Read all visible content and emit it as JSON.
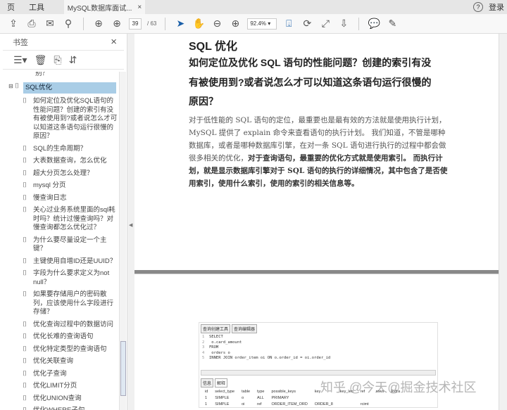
{
  "tabbar": {
    "menu": [
      "页",
      "工具"
    ],
    "doc_tab": "MySQL数据库面试...",
    "close": "×",
    "login": "登录",
    "help": "?"
  },
  "toolbar": {
    "page_current": "39",
    "page_total": "/ 63",
    "zoom": "92.4%"
  },
  "sidebar": {
    "title": "书签",
    "close": "×",
    "items": [
      {
        "label": "别？",
        "level": 1
      },
      {
        "label": "SQL优化",
        "level": 0,
        "selected": true
      },
      {
        "label": "如何定位及优化SQL语句的性能问题？创建的索引有没有被使用到?或者说怎么才可以知道这条语句运行很慢的原因？",
        "level": 1
      },
      {
        "label": "SQL的生命周期？",
        "level": 1
      },
      {
        "label": "大表数据查询，怎么优化",
        "level": 1
      },
      {
        "label": "超大分页怎么处理？",
        "level": 1
      },
      {
        "label": "mysql 分页",
        "level": 1
      },
      {
        "label": "慢查询日志",
        "level": 1
      },
      {
        "label": "关心过业务系统里面的sql耗时吗？统计过慢查询吗？对慢查询都怎么优化过？",
        "level": 1
      },
      {
        "label": "为什么要尽量设定一个主键？",
        "level": 1
      },
      {
        "label": "主键使用自增ID还是UUID？",
        "level": 1
      },
      {
        "label": "字段为什么要求定义为not null？",
        "level": 1
      },
      {
        "label": "如果要存储用户的密码散列，应该使用什么字段进行存储？",
        "level": 1
      },
      {
        "label": "优化查询过程中的数据访问",
        "level": 1
      },
      {
        "label": "优化长难的查询语句",
        "level": 1
      },
      {
        "label": "优化特定类型的查询语句",
        "level": 1
      },
      {
        "label": "优化关联查询",
        "level": 1
      },
      {
        "label": "优化子查询",
        "level": 1
      },
      {
        "label": "优化LIMIT分页",
        "level": 1
      },
      {
        "label": "优化UNION查询",
        "level": 1
      },
      {
        "label": "优化WHERE子句",
        "level": 1
      }
    ]
  },
  "page": {
    "title": "SQL 优化",
    "heading": [
      "如何定位及优化 SQL 语句的性能问题？创建的索引有没",
      "有被使用到?或者说怎么才可以知道这条语句运行很慢的",
      "原因？"
    ],
    "para_normal": "对于低性能的 SQL 语句的定位，最重要也是最有效的方法就是使用执行计划，MySQL 提供了 explain 命令来查看语句的执行计划。 我们知道，不管是哪种数据库，或者是哪种数据库引擎，在对一条 SQL 语句进行执行的过程中都会做很多相关的优化，",
    "para_bold": "对于查询语句，最重要的优化方式就是使用索引。 而执行计划，就是显示数据库引擎对于 SQL 语句的执行的详细情况，其中包含了是否使用索引，使用什么索引，使用的索引的相关信息等。"
  },
  "screenshot": {
    "tabs": [
      "查询创建工具",
      "查询编辑器"
    ],
    "code": [
      [
        "1",
        "SELECT"
      ],
      [
        "2",
        "  o.card_amount"
      ],
      [
        "3",
        "FROM"
      ],
      [
        "4",
        "  orders o"
      ],
      [
        "5",
        "INNER JOIN order_item oi ON o.order_id = oi.order_id"
      ]
    ],
    "result_tabs": [
      "信息",
      "解释"
    ],
    "columns": [
      "id",
      "select_type",
      "table",
      "type",
      "possible_keys",
      "key",
      "key_len",
      "ref",
      "rows",
      "Extra"
    ],
    "rows": [
      [
        "1",
        "SIMPLE",
        "o",
        "ALL",
        "PRIMARY",
        "",
        "",
        "",
        "",
        ""
      ],
      [
        "1",
        "SIMPLE",
        "oi",
        "ref",
        "ORDER_ITEM_ORD",
        "ORDER_8",
        "",
        "rcimt",
        "",
        ""
      ]
    ],
    "watermark": "知乎 @今天@掘金技术社区"
  }
}
